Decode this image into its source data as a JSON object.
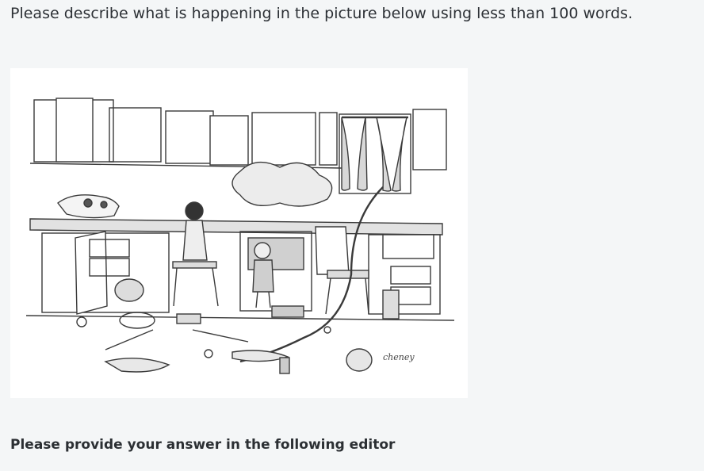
{
  "question": {
    "prompt": "Please describe what is happening in the picture below using less than 100 words."
  },
  "picture": {
    "signature": "cheney"
  },
  "answer": {
    "label": "Please provide your answer in the following editor"
  }
}
